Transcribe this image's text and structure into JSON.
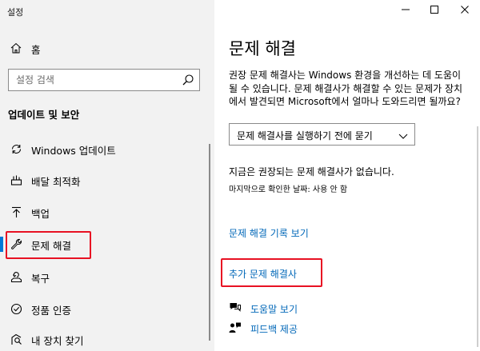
{
  "app": {
    "title": "설정"
  },
  "window_controls": {
    "minimize": "—",
    "maximize": "☐",
    "close": "✕"
  },
  "sidebar": {
    "home_label": "홈",
    "search_placeholder": "설정 검색",
    "section_heading": "업데이트 및 보안",
    "items": [
      {
        "label": "Windows 업데이트",
        "icon": "sync-icon",
        "active": false
      },
      {
        "label": "배달 최적화",
        "icon": "delivery-optimization-icon",
        "active": false
      },
      {
        "label": "백업",
        "icon": "backup-arrow-icon",
        "active": false
      },
      {
        "label": "문제 해결",
        "icon": "wrench-icon",
        "active": true
      },
      {
        "label": "복구",
        "icon": "recovery-icon",
        "active": false
      },
      {
        "label": "정품 인증",
        "icon": "activation-check-icon",
        "active": false
      },
      {
        "label": "내 장치 찾기",
        "icon": "find-device-icon",
        "active": false
      }
    ]
  },
  "main": {
    "title": "문제 해결",
    "description": "권장 문제 해결사는 Windows 환경을 개선하는 데 도움이 될 수 있습니다. 문제 해결사가 해결할 수 있는 문제가 장치에서 발견되면 Microsoft에서 얼마나 도와드리면 될까요?",
    "dropdown": {
      "selected": "문제 해결사를 실행하기 전에 묻기"
    },
    "status": "지금은 권장되는 문제 해결사가 없습니다.",
    "last_check": "마지막으로 확인한 날짜: 사용 안 함",
    "history_link": "문제 해결 기록 보기",
    "additional_link": "추가 문제 해결사",
    "help": [
      {
        "label": "도움말 보기",
        "icon": "help-chat-icon"
      },
      {
        "label": "피드백 제공",
        "icon": "feedback-icon"
      }
    ]
  },
  "colors": {
    "accent": "#0078d7",
    "link": "#0067b8",
    "highlight": "#e81123",
    "sidebar_bg": "#f2f2f2"
  }
}
